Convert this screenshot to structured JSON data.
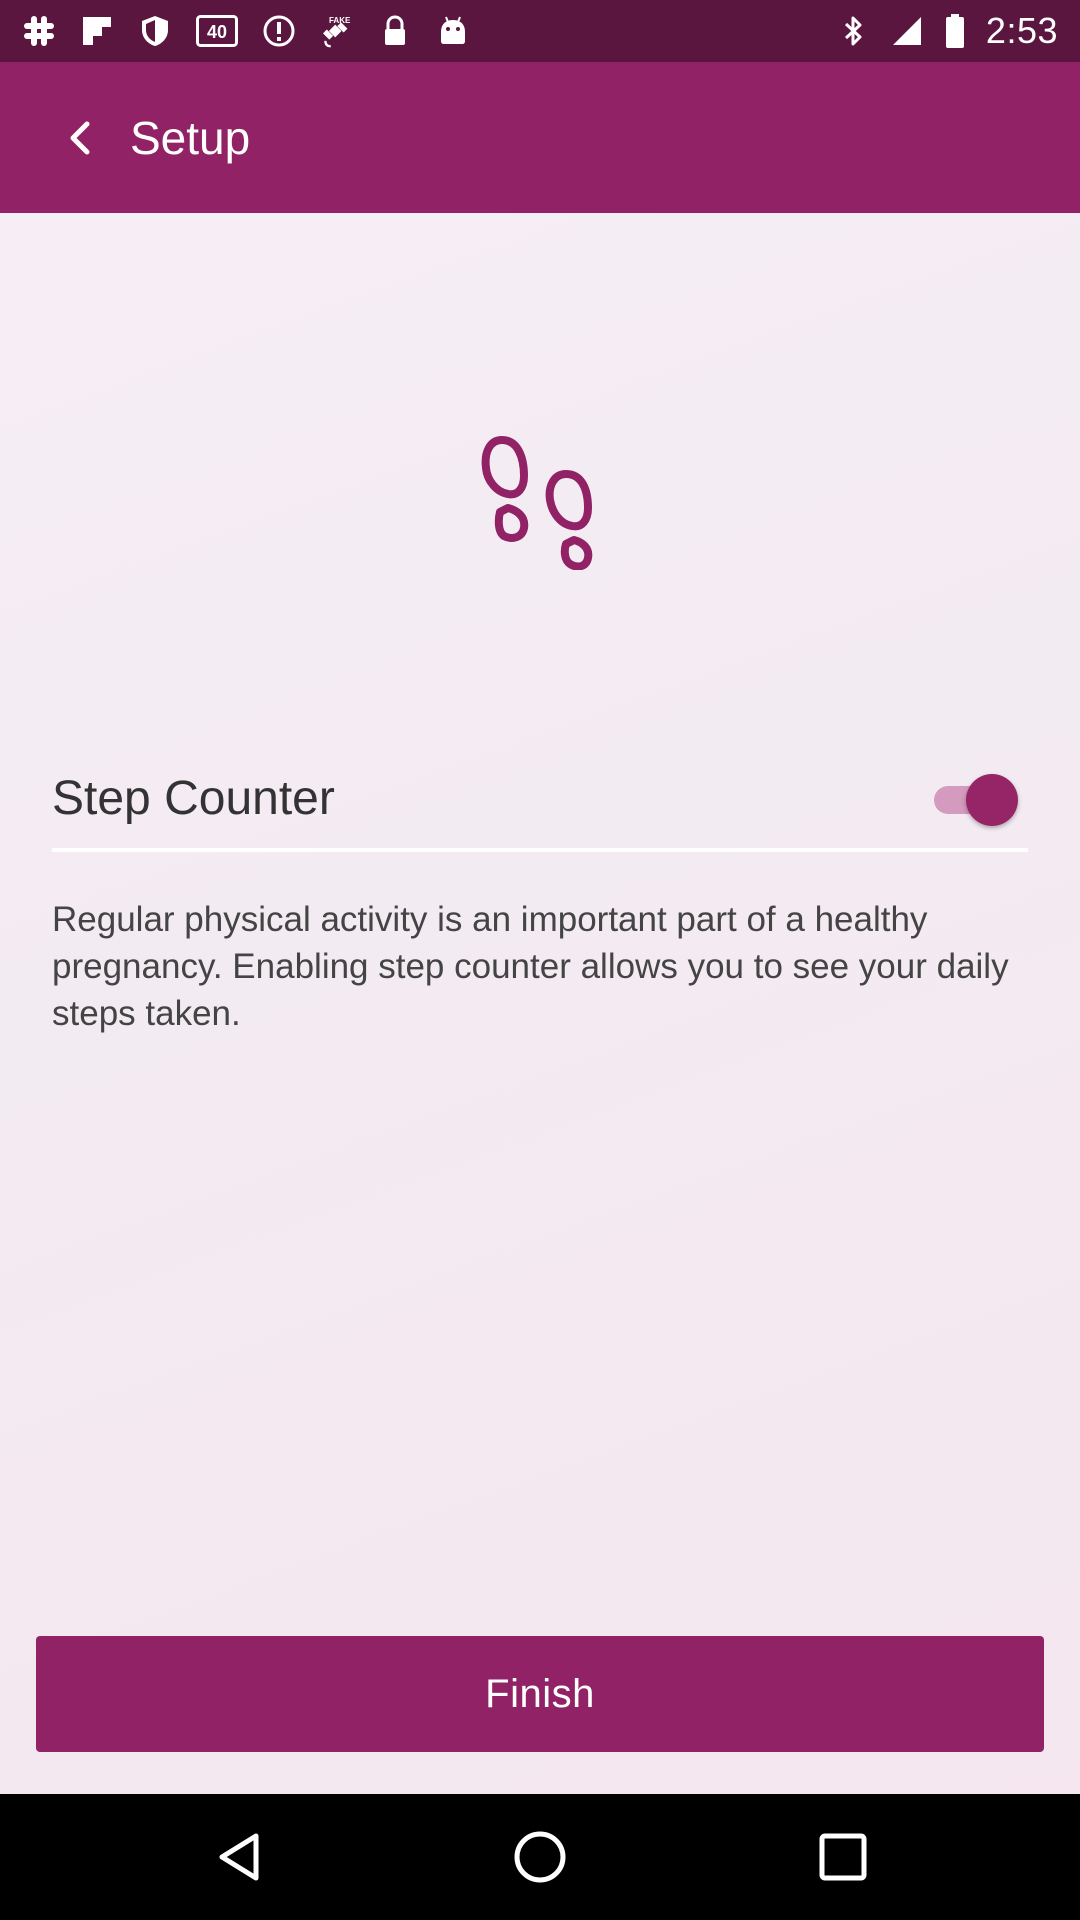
{
  "status_bar": {
    "time": "2:53",
    "icons_left": [
      "slack-icon",
      "flipboard-icon",
      "shield-icon",
      "lte-40-icon",
      "alert-circle-icon",
      "fake-gps-satellite-icon",
      "lock-icon",
      "android-icon"
    ],
    "icons_right": [
      "bluetooth-icon",
      "signal-icon",
      "battery-icon"
    ],
    "lte_label": "40",
    "fake_label": "FAKE"
  },
  "app_bar": {
    "title": "Setup",
    "back_icon": "chevron-left-icon"
  },
  "setting": {
    "label": "Step Counter",
    "enabled": true
  },
  "description": "Regular physical activity is an important part of a healthy pregnancy. Enabling step counter allows you to see your daily steps taken.",
  "finish_button": {
    "label": "Finish"
  },
  "colors": {
    "primary": "#912266",
    "status_bar": "#5a163f",
    "toggle_thumb": "#962567",
    "toggle_track": "#d49abf"
  },
  "nav_bar": {
    "buttons": [
      "back-triangle-icon",
      "home-circle-icon",
      "recents-square-icon"
    ]
  }
}
